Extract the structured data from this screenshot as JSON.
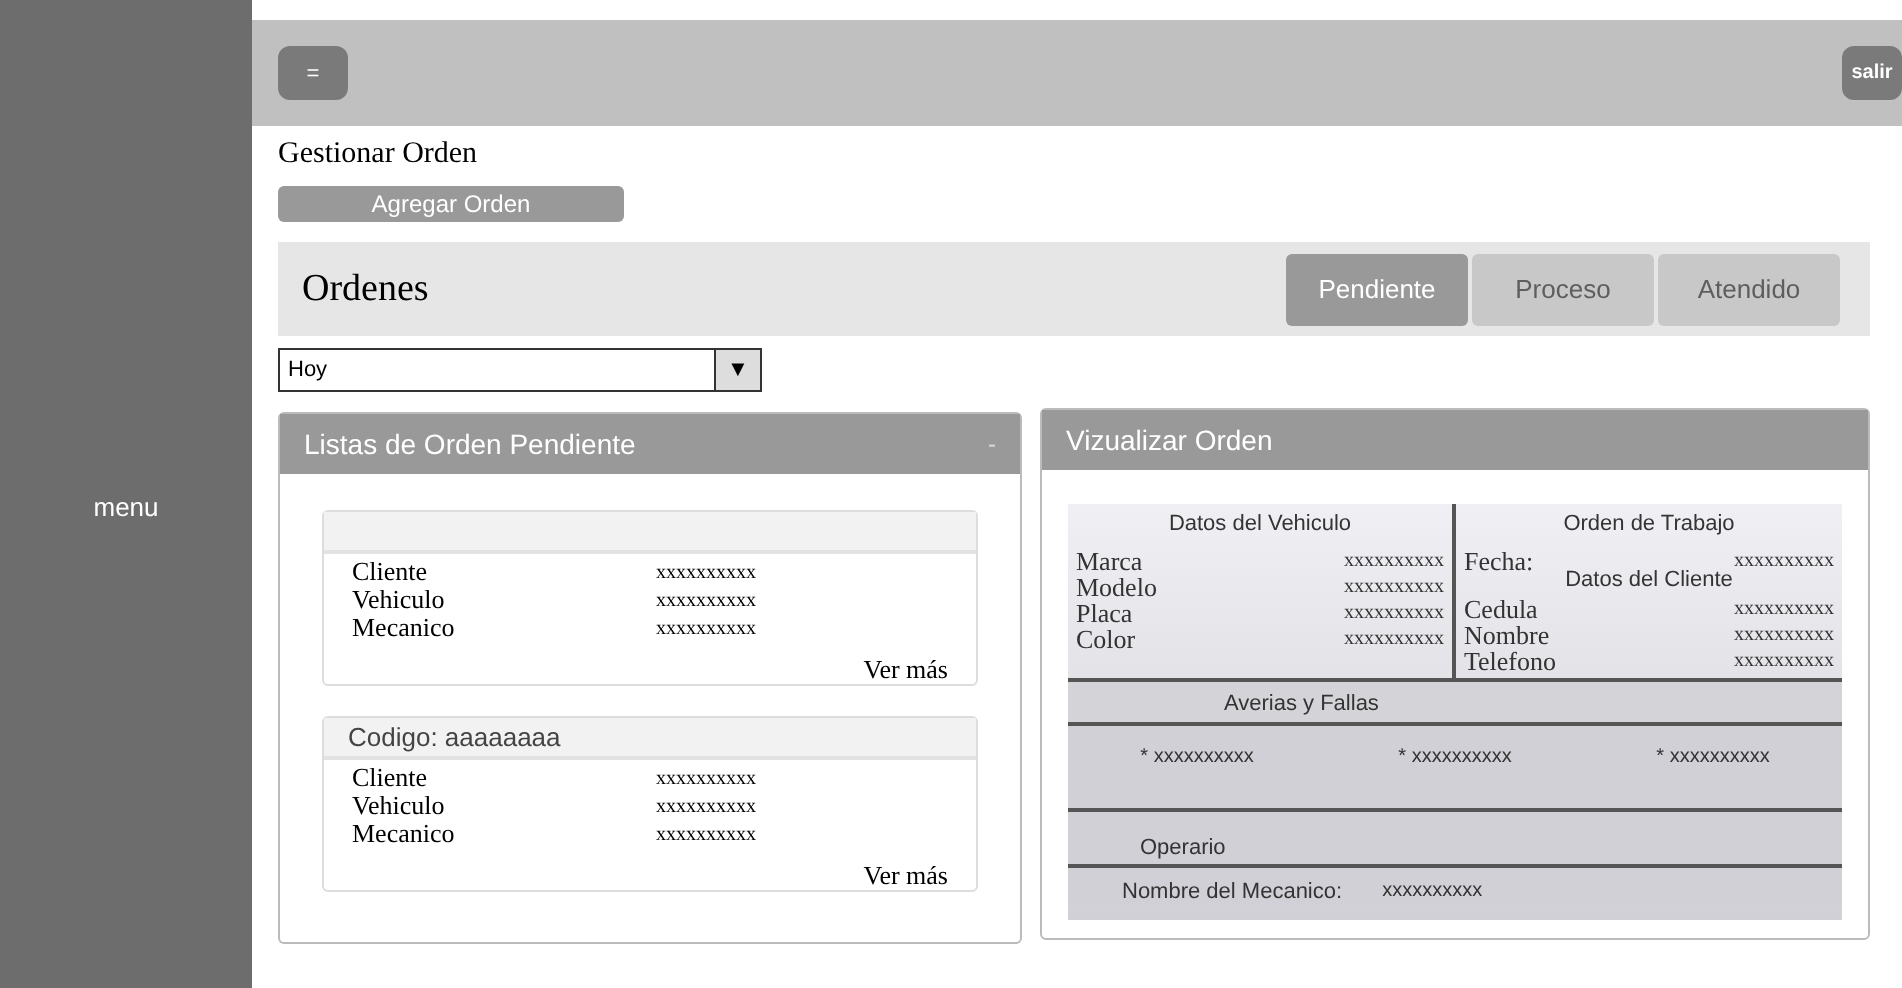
{
  "sidebar": {
    "label": "menu"
  },
  "topbar": {
    "menu_button": "=",
    "exit_button": "salir"
  },
  "page_title": "Gestionar Orden",
  "add_button": "Agregar Orden",
  "orders_header": {
    "title": "Ordenes",
    "tabs": [
      {
        "label": "Pendiente",
        "selected": true
      },
      {
        "label": "Proceso",
        "selected": false
      },
      {
        "label": "Atendido",
        "selected": false
      }
    ]
  },
  "filter": {
    "value": "Hoy",
    "arrow": "▼"
  },
  "list_panel": {
    "title": "Listas de Orden Pendiente",
    "collapse": "-",
    "orders": [
      {
        "fields": [
          {
            "label": "Cliente",
            "value": "xxxxxxxxxx"
          },
          {
            "label": "Vehiculo",
            "value": "xxxxxxxxxx"
          },
          {
            "label": "Mecanico",
            "value": "xxxxxxxxxx"
          }
        ],
        "link": "Ver más"
      },
      {
        "code": "Codigo: aaaaaaaa",
        "fields": [
          {
            "label": "Cliente",
            "value": "xxxxxxxxxx"
          },
          {
            "label": "Vehiculo",
            "value": "xxxxxxxxxx"
          },
          {
            "label": "Mecanico",
            "value": "xxxxxxxxxx"
          }
        ],
        "link": "Ver más"
      }
    ]
  },
  "detail_panel": {
    "title": "Vizualizar Orden",
    "vehicle": {
      "title": "Datos del Vehiculo",
      "fields": [
        {
          "label": "Marca",
          "value": "xxxxxxxxxx"
        },
        {
          "label": "Modelo",
          "value": "xxxxxxxxxx"
        },
        {
          "label": "Placa",
          "value": "xxxxxxxxxx"
        },
        {
          "label": "Color",
          "value": "xxxxxxxxxx"
        }
      ]
    },
    "work_order": {
      "title": "Orden de Trabajo",
      "date_label": "Fecha:",
      "date_value": "xxxxxxxxxx",
      "client_title": "Datos del Cliente",
      "fields": [
        {
          "label": "Cedula",
          "value": "xxxxxxxxxx"
        },
        {
          "label": "Nombre",
          "value": "xxxxxxxxxx"
        },
        {
          "label": "Telefono",
          "value": "xxxxxxxxxx"
        }
      ]
    },
    "faults": {
      "title": "Averias y Fallas",
      "items": [
        "* xxxxxxxxxx",
        "* xxxxxxxxxx",
        "* xxxxxxxxxx"
      ]
    },
    "operator": {
      "title": "Operario",
      "label": "Nombre del Mecanico:",
      "value": "xxxxxxxxxx"
    }
  }
}
